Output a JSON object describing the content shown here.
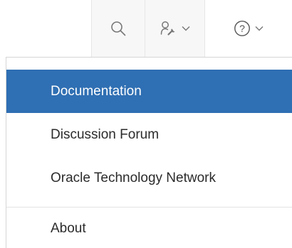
{
  "toolbar": {
    "buttons": [
      {
        "icon": "search-icon"
      },
      {
        "icon": "admin-wrench-icon",
        "caret": "chevron-down-icon"
      },
      {
        "icon": "help-icon",
        "caret": "chevron-down-icon"
      }
    ],
    "help_glyph": "?"
  },
  "menu": {
    "items": [
      {
        "label": "Documentation",
        "active": true
      },
      {
        "label": "Discussion Forum",
        "active": false
      },
      {
        "label": "Oracle Technology Network",
        "active": false
      },
      {
        "label": "About",
        "active": false
      }
    ]
  },
  "colors": {
    "active_background": "#2f6fb3",
    "active_text": "#ffffff",
    "text": "#2b2b2b",
    "icon": "#777777"
  }
}
